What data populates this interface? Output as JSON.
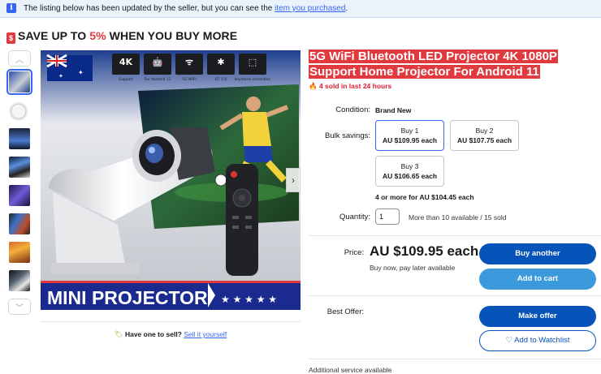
{
  "notice": {
    "icon": "info-icon",
    "text": "The listing below has been updated by the seller, but you can see the ",
    "link": "item you purchased",
    "end": "."
  },
  "promo": {
    "prefix": "SAVE UP TO ",
    "percent": "5%",
    "suffix": " WHEN YOU BUY MORE",
    "icon": "price-tag-icon"
  },
  "gallery": {
    "thumb_count": 9,
    "selected_index": 0,
    "image_badges": [
      {
        "big": "4K",
        "small": "Support"
      },
      {
        "big": "🤖",
        "small": "For Android 11"
      },
      {
        "big": "ᯤ",
        "small": "5G WIFI"
      },
      {
        "big": "✱",
        "small": "BT 5.0"
      },
      {
        "big": "⬚",
        "small": "keystone correction"
      }
    ],
    "image_banner": "MINI PROJECTOR",
    "banner_stars": "★ ★ ★ ★ ★"
  },
  "sell": {
    "icon": "tag-icon",
    "text": "Have one to sell?",
    "link": "Sell it yourself"
  },
  "product": {
    "title": "5G WiFi Bluetooth LED Projector 4K 1080P Support Home Projector For Android 11",
    "sold": "4 sold in last 24 hours",
    "sold_icon": "flame-icon"
  },
  "details": {
    "condition_label": "Condition:",
    "condition_value": "Brand New",
    "bulk_label": "Bulk savings:",
    "bulk_options": [
      {
        "qty": "Buy 1",
        "price": "AU $109.95 each"
      },
      {
        "qty": "Buy 2",
        "price": "AU $107.75 each"
      },
      {
        "qty": "Buy 3",
        "price": "AU $106.65 each"
      }
    ],
    "bulk_more": "4 or more for AU $104.45 each",
    "quantity_label": "Quantity:",
    "quantity_value": "1",
    "availability": "More than 10 available / 15 sold"
  },
  "purchase": {
    "price_label": "Price:",
    "price": "AU $109.95 each",
    "pay_later": "Buy now, pay later available",
    "buy_another": "Buy another",
    "add_to_cart": "Add to cart",
    "best_offer_label": "Best Offer:",
    "make_offer": "Make offer",
    "watchlist": "♡ Add to Watchlist",
    "additional": "Additional service available"
  },
  "colors": {
    "accent_blue": "#3665f3",
    "button_blue": "#0654ba",
    "cart_blue": "#3b9adb",
    "title_red": "#e0393e"
  }
}
